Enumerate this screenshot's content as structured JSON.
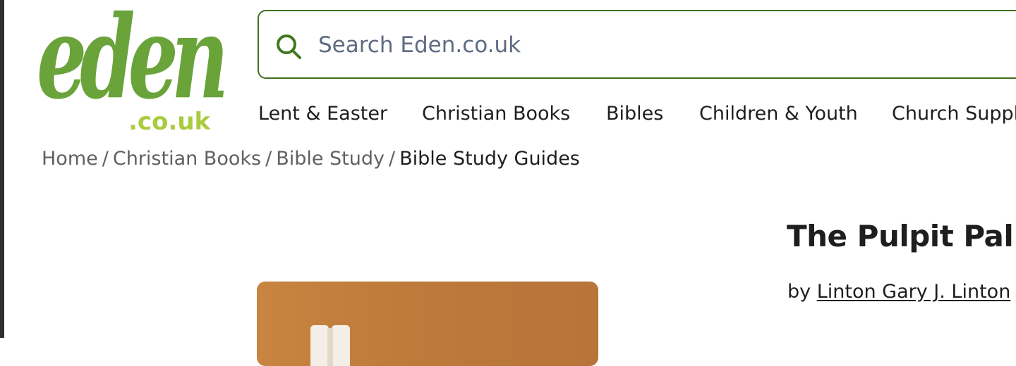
{
  "logo": {
    "brand": "eden",
    "suffix": ".co.uk"
  },
  "search": {
    "placeholder": "Search Eden.co.uk",
    "value": "",
    "icon": "search-icon"
  },
  "nav": {
    "items": [
      {
        "label": "Lent & Easter"
      },
      {
        "label": "Christian Books"
      },
      {
        "label": "Bibles"
      },
      {
        "label": "Children & Youth"
      },
      {
        "label": "Church Suppl"
      }
    ]
  },
  "breadcrumb": {
    "items": [
      {
        "label": "Home"
      },
      {
        "label": "Christian Books"
      },
      {
        "label": "Bible Study"
      }
    ],
    "separator": "/",
    "current": "Bible Study Guides"
  },
  "product": {
    "title": "The Pulpit Pal: T",
    "by_label": "by",
    "author": "Linton Gary J. Linton"
  },
  "colors": {
    "brand_green": "#6aa33a",
    "brand_lime": "#a9cc3e",
    "search_border": "#3f6e1c",
    "placeholder": "#5d6b82",
    "breadcrumb_link": "#606060",
    "text": "#1e1e1e",
    "image_orange": "#c88440"
  }
}
